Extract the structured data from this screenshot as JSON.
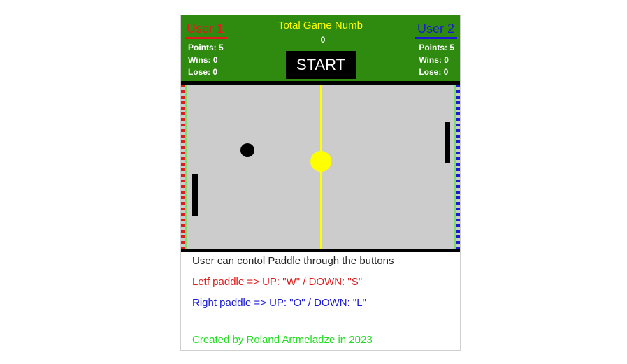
{
  "header": {
    "user1": {
      "name": "User 1",
      "points_label": "Points: 5",
      "wins_label": "Wins: 0",
      "lose_label": "Lose: 0"
    },
    "user2": {
      "name": "User 2",
      "points_label": "Points: 5",
      "wins_label": "Wins: 0",
      "lose_label": "Lose: 0"
    },
    "total_title": "Total Game Numb",
    "total_value": "0",
    "start_label": "START"
  },
  "instructions": {
    "main": "User can contol Paddle through the buttons",
    "left": "Letf paddle  => UP: \"W\" / DOWN: \"S\"",
    "right": "Right paddle  => UP: \"O\" / DOWN: \"L\""
  },
  "credit": "Created by Roland Artmeladze in 2023",
  "colors": {
    "scoreboard": "#2e8b0f",
    "user1": "#e01b1b",
    "user2": "#1a1ad6",
    "accent": "#ffff00",
    "field": "#cccccc",
    "credit": "#22dd22"
  }
}
